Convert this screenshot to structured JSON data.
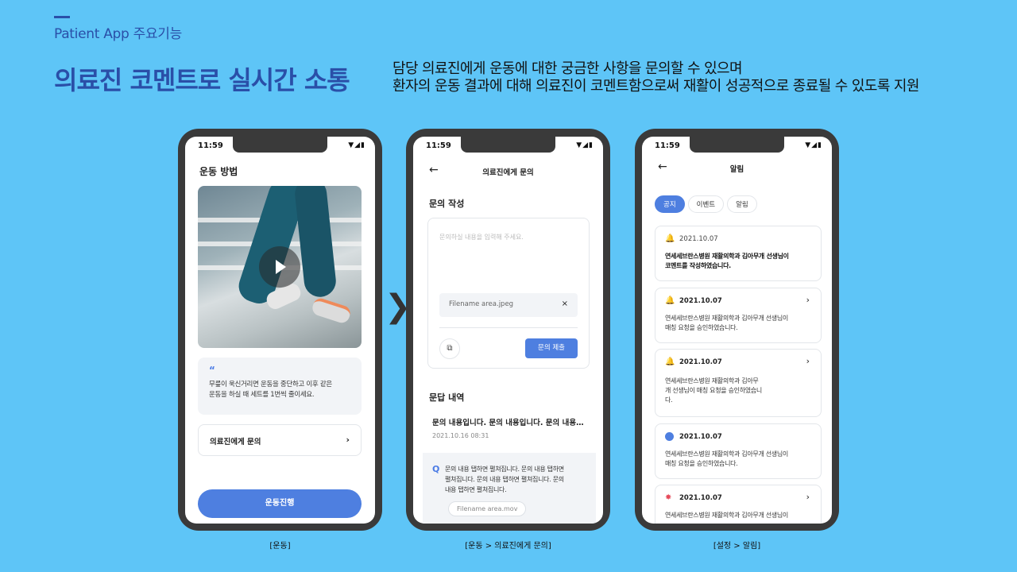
{
  "header": {
    "eyebrow": "Patient App 주요기능",
    "headline": "의료진 코멘트로 실시간 소통",
    "description_line1": "담당 의료진에게 운동에 대한 궁금한 사항을 문의할 수 있으며",
    "description_line2": "환자의 운동 결과에 대해 의료진이 코멘트함으로써 재활이 성공적으로 종료될 수 있도록 지원"
  },
  "status_bar": {
    "time": "11:59",
    "icons": "▼◢▮"
  },
  "phone1": {
    "title": "운동 방법",
    "tip_quote_mark": "“",
    "tip_line1": "무릎이 욱신거리면 운동을 중단하고 이후 같은",
    "tip_line2": "운동을 하실 때 세트를 1번씩 줄이세요.",
    "ask_label": "의료진에게 문의",
    "ask_chevron": "›",
    "cta_label": "운동진행",
    "caption": "[운동]"
  },
  "between_arrow": "❯",
  "phone2": {
    "back": "←",
    "title": "의료진에게 문의",
    "compose_title": "문의 작성",
    "placeholder": "문의하실 내용을 입력해 주세요.",
    "attachment_name": "Filename area.jpeg",
    "attachment_remove": "×",
    "image_button_icon": "⧉",
    "submit_label": "문의 제출",
    "reply_title": "문답 내역",
    "reply_preview": "문의 내용입니다. 문의 내용입니다. 문의 내용…",
    "reply_date": "2021.10.16 08:31",
    "q_mark": "Q",
    "q_line1": "문의 내용 탭하면 펼쳐집니다. 문의 내용 탭하면",
    "q_line2": "펼쳐집니다. 문의 내용 탭하면 펼쳐집니다. 문의",
    "q_line3": "내용 탭하면 펼쳐집니다.",
    "q_attachment": "Filename area.mov",
    "caption": "[운동 > 의료진에게 문의]"
  },
  "phone3": {
    "back": "←",
    "title": "알림",
    "tabs": [
      "공지",
      "이벤트",
      "알림"
    ],
    "notifications": [
      {
        "date": "2021.10.07",
        "line1": "연세세브란스병원 재활의학과 김아무개 선생님이",
        "line2": "코멘트를 작성하였습니다.",
        "line3": ""
      },
      {
        "date": "2021.10.07",
        "line1": "연세세브란스병원 재활의학과 김아무개 선생님이",
        "line2": "매칭 요청을 승인하였습니다.",
        "line3": ""
      },
      {
        "date": "2021.10.07",
        "line1": "연세세브란스병원 재활의학과 김아무",
        "line2": "개 선생님이 매칭 요청을 승인하였습니",
        "line3": "다."
      },
      {
        "date": "2021.10.07",
        "line1": "연세세브란스병원 재활의학과 김아무개 선생님이",
        "line2": "매칭 요청을 승인하였습니다.",
        "line3": ""
      },
      {
        "date": "2021.10.07",
        "line1": "연세세브란스병원 재활의학과 김아무개 선생님이",
        "line2": "",
        "line3": ""
      }
    ],
    "icons": {
      "bell": "bell-icon",
      "bubble": "chat-bubble-icon",
      "star": "star-badge-icon"
    },
    "chevron": "›",
    "caption": "[설정 > 알림]"
  },
  "colors": {
    "background": "#5ec5f7",
    "brand": "#2a4fa8",
    "primary": "#4e7fe0",
    "phone_frame": "#3a3a3a"
  }
}
